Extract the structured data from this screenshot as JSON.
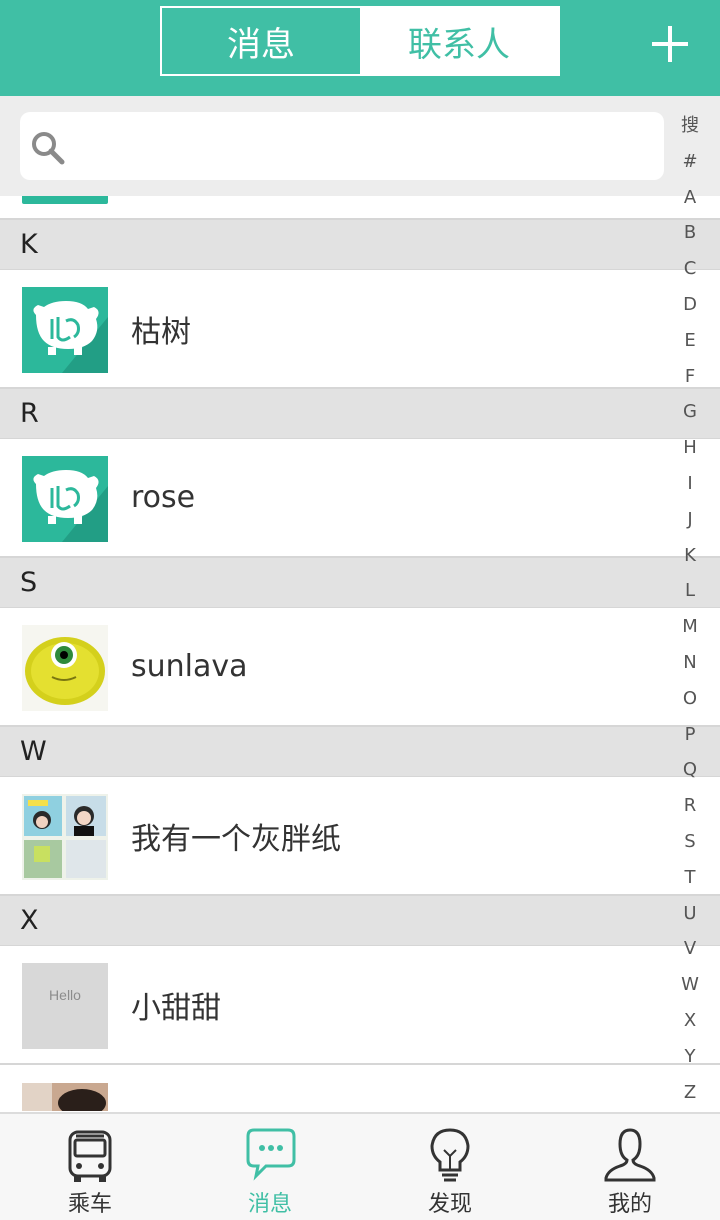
{
  "header": {
    "tabs": [
      {
        "label": "消息",
        "active": true
      },
      {
        "label": "联系人",
        "active": false
      }
    ],
    "add_icon": "plus-icon"
  },
  "search": {
    "placeholder": "",
    "icon": "search-icon"
  },
  "index_letters": [
    "搜",
    "#",
    "A",
    "B",
    "C",
    "D",
    "E",
    "F",
    "G",
    "H",
    "I",
    "J",
    "K",
    "L",
    "M",
    "N",
    "O",
    "P",
    "Q",
    "R",
    "S",
    "T",
    "U",
    "V",
    "W",
    "X",
    "Y",
    "Z"
  ],
  "contacts": [
    {
      "section": "K",
      "name": "枯树",
      "avatar": "green-logo-avatar"
    },
    {
      "section": "R",
      "name": "rose",
      "avatar": "green-logo-avatar"
    },
    {
      "section": "S",
      "name": "sunlava",
      "avatar": "yellow-monster-avatar"
    },
    {
      "section": "W",
      "name": "我有一个灰胖纸",
      "avatar": "photo-collage-avatar"
    },
    {
      "section": "X",
      "name": "小甜甜",
      "avatar": "hello-gray-avatar",
      "avatar_text": "Hello"
    }
  ],
  "bottom_nav": [
    {
      "label": "乘车",
      "icon": "bus-icon",
      "active": false
    },
    {
      "label": "消息",
      "icon": "chat-bubble-icon",
      "active": true
    },
    {
      "label": "发现",
      "icon": "lightbulb-icon",
      "active": false
    },
    {
      "label": "我的",
      "icon": "person-icon",
      "active": false
    }
  ],
  "colors": {
    "accent": "#40bfa5",
    "section_bg": "#e2e2e2",
    "search_bg": "#ededed"
  }
}
